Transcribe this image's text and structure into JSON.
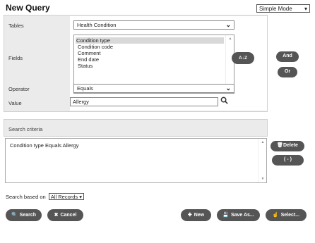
{
  "title": "New Query",
  "mode": {
    "selected": "Simple Mode"
  },
  "form": {
    "tables_label": "Tables",
    "tables_value": "Health Condition",
    "fields_label": "Fields",
    "fields_options": [
      "Condition type",
      "Condition code",
      "Comment",
      "End date",
      "Status"
    ],
    "fields_selected": "Condition type",
    "operator_label": "Operator",
    "operator_value": "Equals",
    "value_label": "Value",
    "value_value": "Allergy"
  },
  "buttons": {
    "sort_glyph": "A↓Z",
    "and": "And",
    "or": "Or",
    "delete": "Delete",
    "paren": "( - )",
    "search": "Search",
    "cancel": "Cancel",
    "new": "New",
    "save_as": "Save As...",
    "select": "Select..."
  },
  "criteria": {
    "header": "Search criteria",
    "lines": [
      "Condition type Equals Allergy"
    ]
  },
  "search_based": {
    "label": "Search based on",
    "value": "All Records"
  }
}
